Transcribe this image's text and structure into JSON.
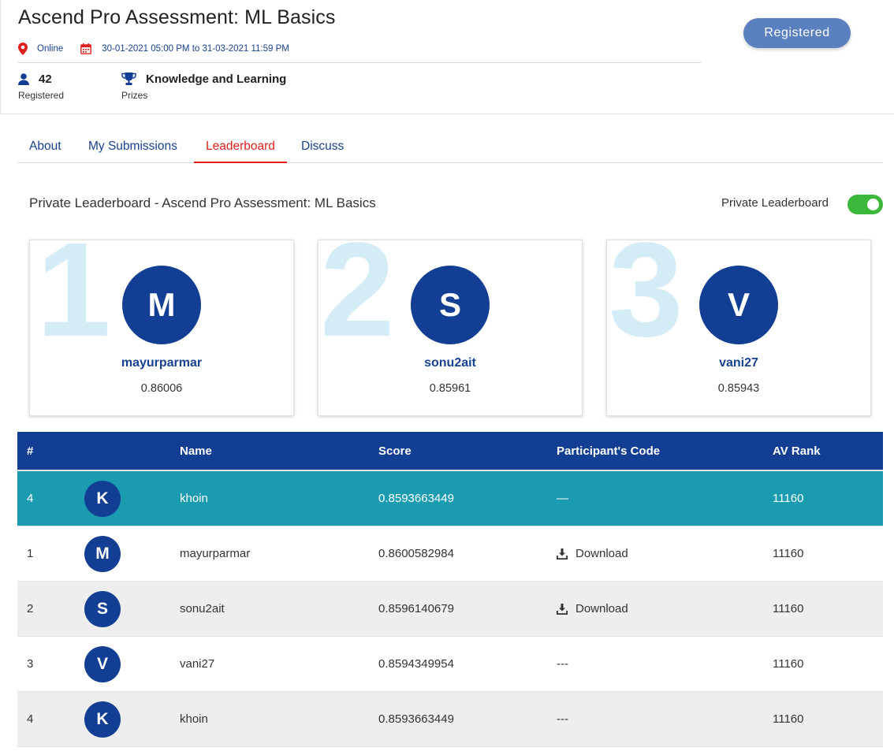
{
  "header": {
    "title": "Ascend Pro Assessment: ML Basics",
    "location": "Online",
    "dates": "30-01-2021 05:00 PM to 31-03-2021 11:59 PM",
    "registered_count": "42",
    "registered_label": "Registered",
    "prize_value": "Knowledge and Learning",
    "prize_label": "Prizes",
    "register_button": "Registered"
  },
  "tabs": [
    {
      "label": "About"
    },
    {
      "label": "My Submissions"
    },
    {
      "label": "Leaderboard",
      "active": true
    },
    {
      "label": "Discuss"
    }
  ],
  "leaderboard": {
    "title": "Private Leaderboard - Ascend Pro Assessment: ML Basics",
    "toggle_label": "Private Leaderboard",
    "toggle_on": true
  },
  "podium": [
    {
      "rank": "1",
      "initial": "M",
      "name": "mayurparmar",
      "score": "0.86006"
    },
    {
      "rank": "2",
      "initial": "S",
      "name": "sonu2ait",
      "score": "0.85961"
    },
    {
      "rank": "3",
      "initial": "V",
      "name": "vani27",
      "score": "0.85943"
    }
  ],
  "table": {
    "columns": [
      "#",
      "Name",
      "Score",
      "Participant's Code",
      "AV Rank"
    ],
    "rows": [
      {
        "rank": "4",
        "initial": "K",
        "name": "khoin",
        "score": "0.8593663449",
        "code": "—",
        "av_rank": "11160"
      },
      {
        "rank": "1",
        "initial": "M",
        "name": "mayurparmar",
        "score": "0.8600582984",
        "code": "Download",
        "av_rank": "11160"
      },
      {
        "rank": "2",
        "initial": "S",
        "name": "sonu2ait",
        "score": "0.8596140679",
        "code": "Download",
        "av_rank": "11160"
      },
      {
        "rank": "3",
        "initial": "V",
        "name": "vani27",
        "score": "0.8594349954",
        "code": "---",
        "av_rank": "11160"
      },
      {
        "rank": "4",
        "initial": "K",
        "name": "khoin",
        "score": "0.8593663449",
        "code": "---",
        "av_rank": "11160"
      }
    ]
  },
  "colors": {
    "brand_blue": "#123e93",
    "link_blue": "#17418f",
    "active_tab": "#e0201c",
    "highlight_row": "#1b9bb0",
    "toggle_on": "#3bb73b",
    "button": "#5b80c0"
  }
}
